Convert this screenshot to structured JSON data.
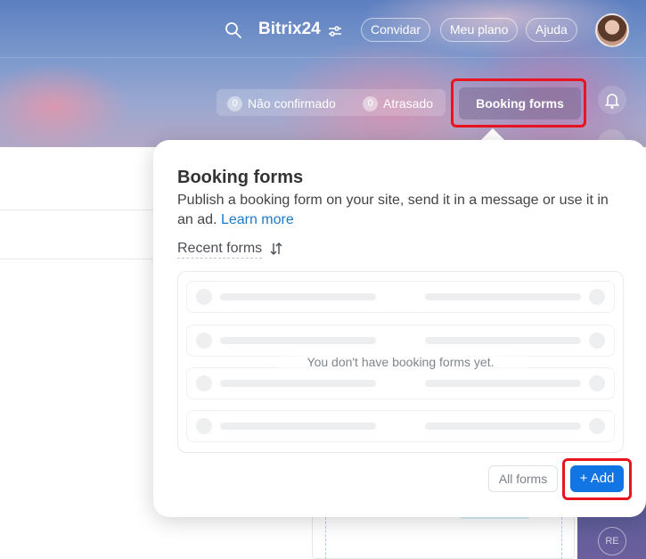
{
  "header": {
    "brand": "Bitrix24",
    "buttons": {
      "invite": "Convidar",
      "plan": "Meu plano",
      "help": "Ajuda"
    }
  },
  "counters": [
    {
      "count": "0",
      "label": "Não confirmado"
    },
    {
      "count": "0",
      "label": "Atrasado"
    }
  ],
  "booking_button": {
    "label": "Booking forms"
  },
  "popup": {
    "title": "Booking forms",
    "description": "Publish a booking form on your site, send it in a message or use it in an ad.",
    "learn_more": "Learn more",
    "recent_label": "Recent forms",
    "empty_message": "You don't have booking forms yet.",
    "all_forms": "All forms",
    "add": "+ Add"
  },
  "misc": {
    "re_avatar": "RE"
  },
  "colors": {
    "highlight": "#e8141f",
    "primary": "#1176e3",
    "link": "#1e7bc9"
  },
  "icons": [
    "search-icon",
    "settings-sliders-icon",
    "bell-icon",
    "sort-icon",
    "avatar"
  ]
}
